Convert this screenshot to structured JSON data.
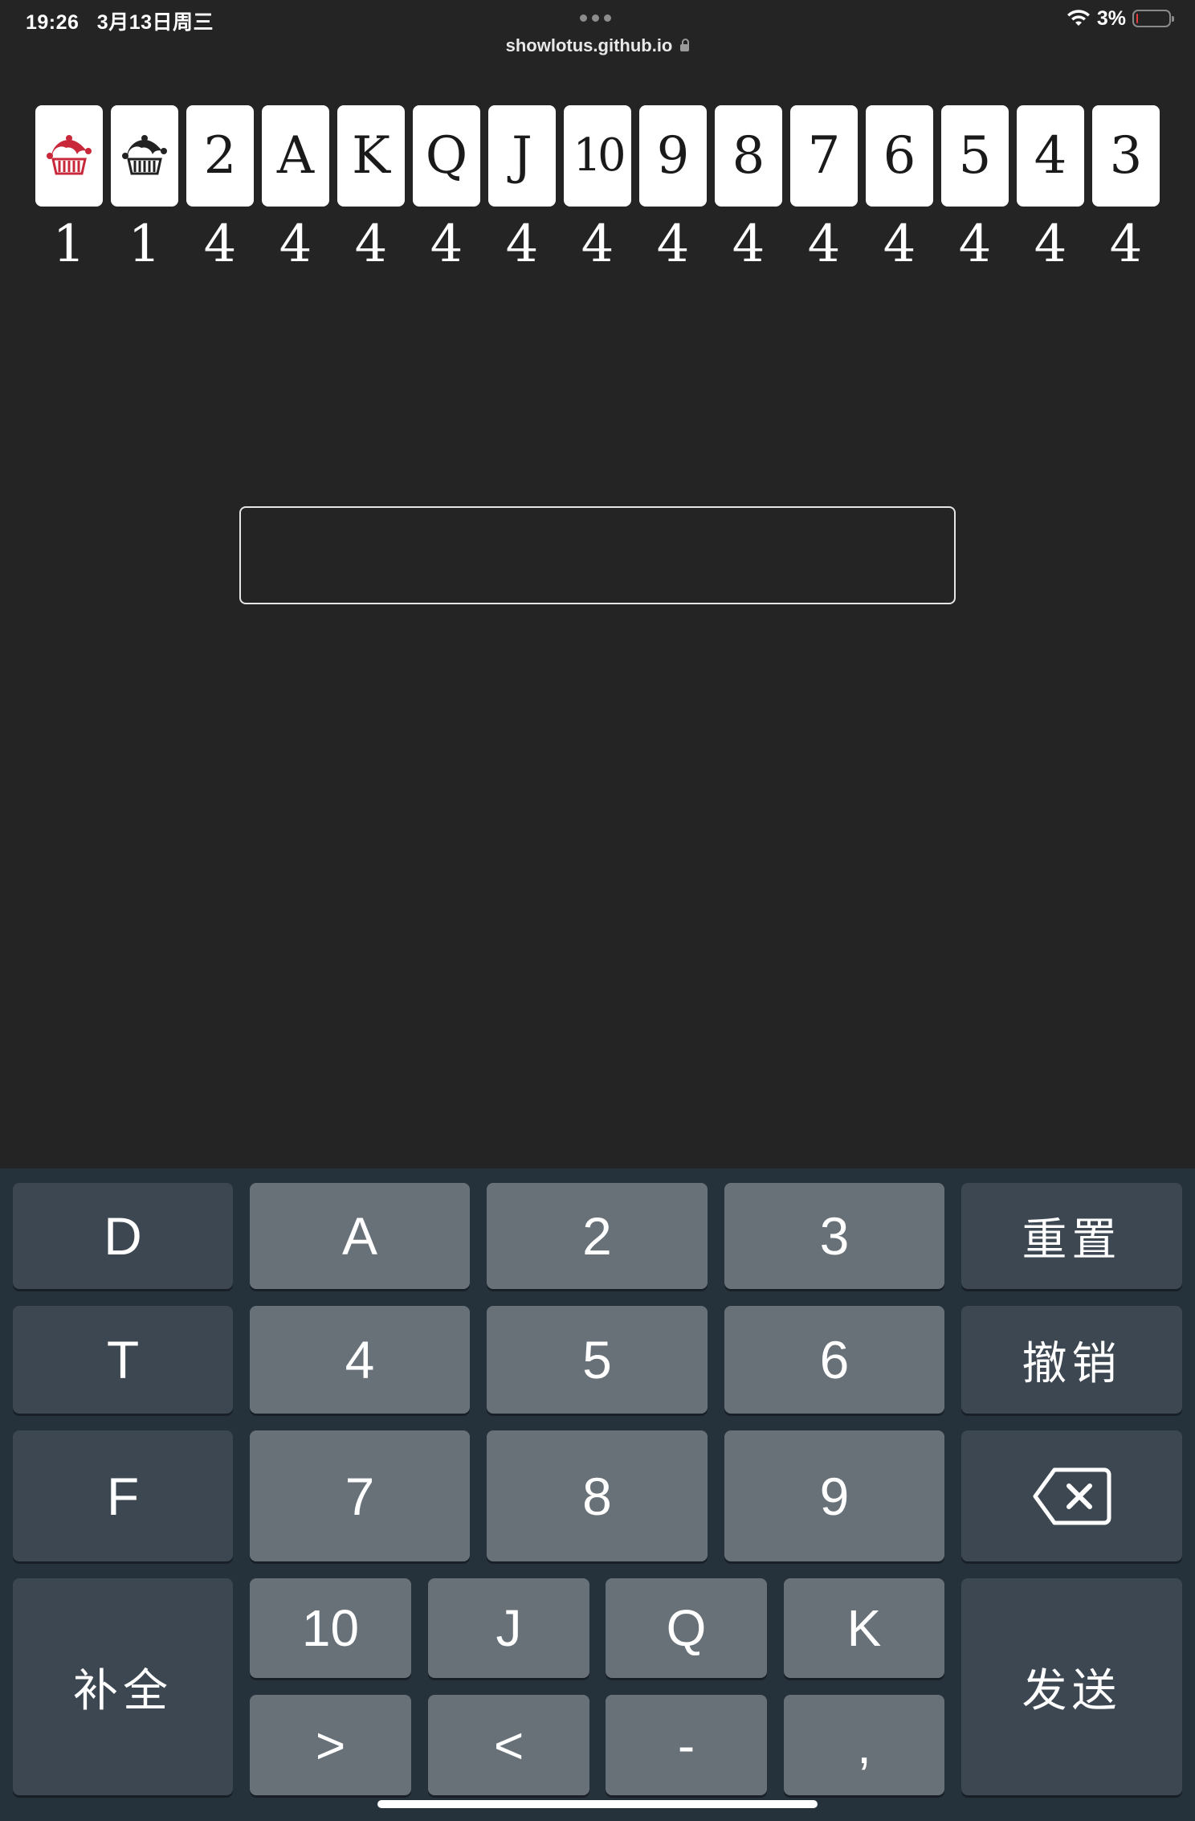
{
  "status": {
    "time": "19:26",
    "date": "3月13日周三",
    "battery_pct": "3%",
    "battery_level": 0.03
  },
  "browser": {
    "url": "showlotus.github.io"
  },
  "cards": [
    {
      "rank": "joker-red",
      "icon": "joker-red-icon",
      "color": "#c8283a",
      "count": "1"
    },
    {
      "rank": "joker-black",
      "icon": "joker-black-icon",
      "color": "#222222",
      "count": "1"
    },
    {
      "rank": "2",
      "count": "4"
    },
    {
      "rank": "A",
      "count": "4"
    },
    {
      "rank": "K",
      "count": "4"
    },
    {
      "rank": "Q",
      "count": "4"
    },
    {
      "rank": "J",
      "count": "4"
    },
    {
      "rank": "10",
      "count": "4"
    },
    {
      "rank": "9",
      "count": "4"
    },
    {
      "rank": "8",
      "count": "4"
    },
    {
      "rank": "7",
      "count": "4"
    },
    {
      "rank": "6",
      "count": "4"
    },
    {
      "rank": "5",
      "count": "4"
    },
    {
      "rank": "4",
      "count": "4"
    },
    {
      "rank": "3",
      "count": "4"
    }
  ],
  "input": {
    "value": "",
    "placeholder": ""
  },
  "keyboard": {
    "row1": [
      "D",
      "A",
      "2",
      "3",
      "重置"
    ],
    "row2": [
      "T",
      "4",
      "5",
      "6",
      "撤销"
    ],
    "row3": [
      "F",
      "7",
      "8",
      "9"
    ],
    "backspace_icon": "backspace-icon",
    "complete": "补全",
    "send": "发送",
    "row4": [
      "10",
      "J",
      "Q",
      "K"
    ],
    "row5": [
      ">",
      "<",
      "-",
      ","
    ]
  }
}
